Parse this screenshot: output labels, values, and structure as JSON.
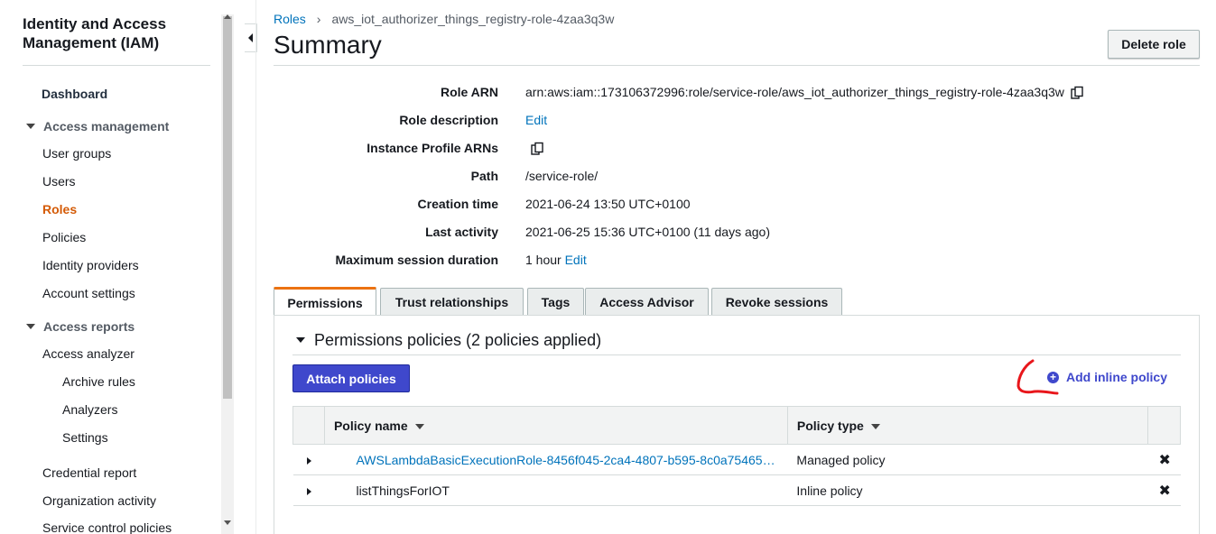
{
  "sidebar": {
    "title": "Identity and Access Management (IAM)",
    "dashboard": "Dashboard",
    "access_management": {
      "label": "Access management",
      "items": [
        "User groups",
        "Users",
        "Roles",
        "Policies",
        "Identity providers",
        "Account settings"
      ],
      "active": "Roles"
    },
    "access_reports": {
      "label": "Access reports",
      "analyzer": "Access analyzer",
      "analyzer_items": [
        "Archive rules",
        "Analyzers",
        "Settings"
      ],
      "items": [
        "Credential report",
        "Organization activity",
        "Service control policies"
      ]
    }
  },
  "breadcrumb": {
    "parent": "Roles",
    "current": "aws_iot_authorizer_things_registry-role-4zaa3q3w"
  },
  "page": {
    "title": "Summary",
    "delete_button": "Delete role"
  },
  "summary": {
    "role_arn_label": "Role ARN",
    "role_arn": "arn:aws:iam::173106372996:role/service-role/aws_iot_authorizer_things_registry-role-4zaa3q3w",
    "role_description_label": "Role description",
    "role_description_edit": "Edit",
    "instance_profile_label": "Instance Profile ARNs",
    "path_label": "Path",
    "path": "/service-role/",
    "creation_time_label": "Creation time",
    "creation_time": "2021-06-24 13:50 UTC+0100",
    "last_activity_label": "Last activity",
    "last_activity": "2021-06-25 15:36 UTC+0100 (11 days ago)",
    "max_session_label": "Maximum session duration",
    "max_session": "1 hour",
    "max_session_edit": "Edit"
  },
  "tabs": [
    "Permissions",
    "Trust relationships",
    "Tags",
    "Access Advisor",
    "Revoke sessions"
  ],
  "permissions": {
    "heading": "Permissions policies (2 policies applied)",
    "attach_button": "Attach policies",
    "add_inline": "Add inline policy",
    "columns": [
      "Policy name",
      "Policy type"
    ],
    "rows": [
      {
        "name": "AWSLambdaBasicExecutionRole-8456f045-2ca4-4807-b595-8c0a75465…",
        "type": "Managed policy",
        "link": true
      },
      {
        "name": "listThingsForIOT",
        "type": "Inline policy",
        "link": false
      }
    ]
  },
  "colors": {
    "link": "#0073bb",
    "active_nav": "#d45b07",
    "primary_button": "#3f48cc",
    "tab_accent": "#ec7211",
    "annotation": "#e8161b"
  }
}
